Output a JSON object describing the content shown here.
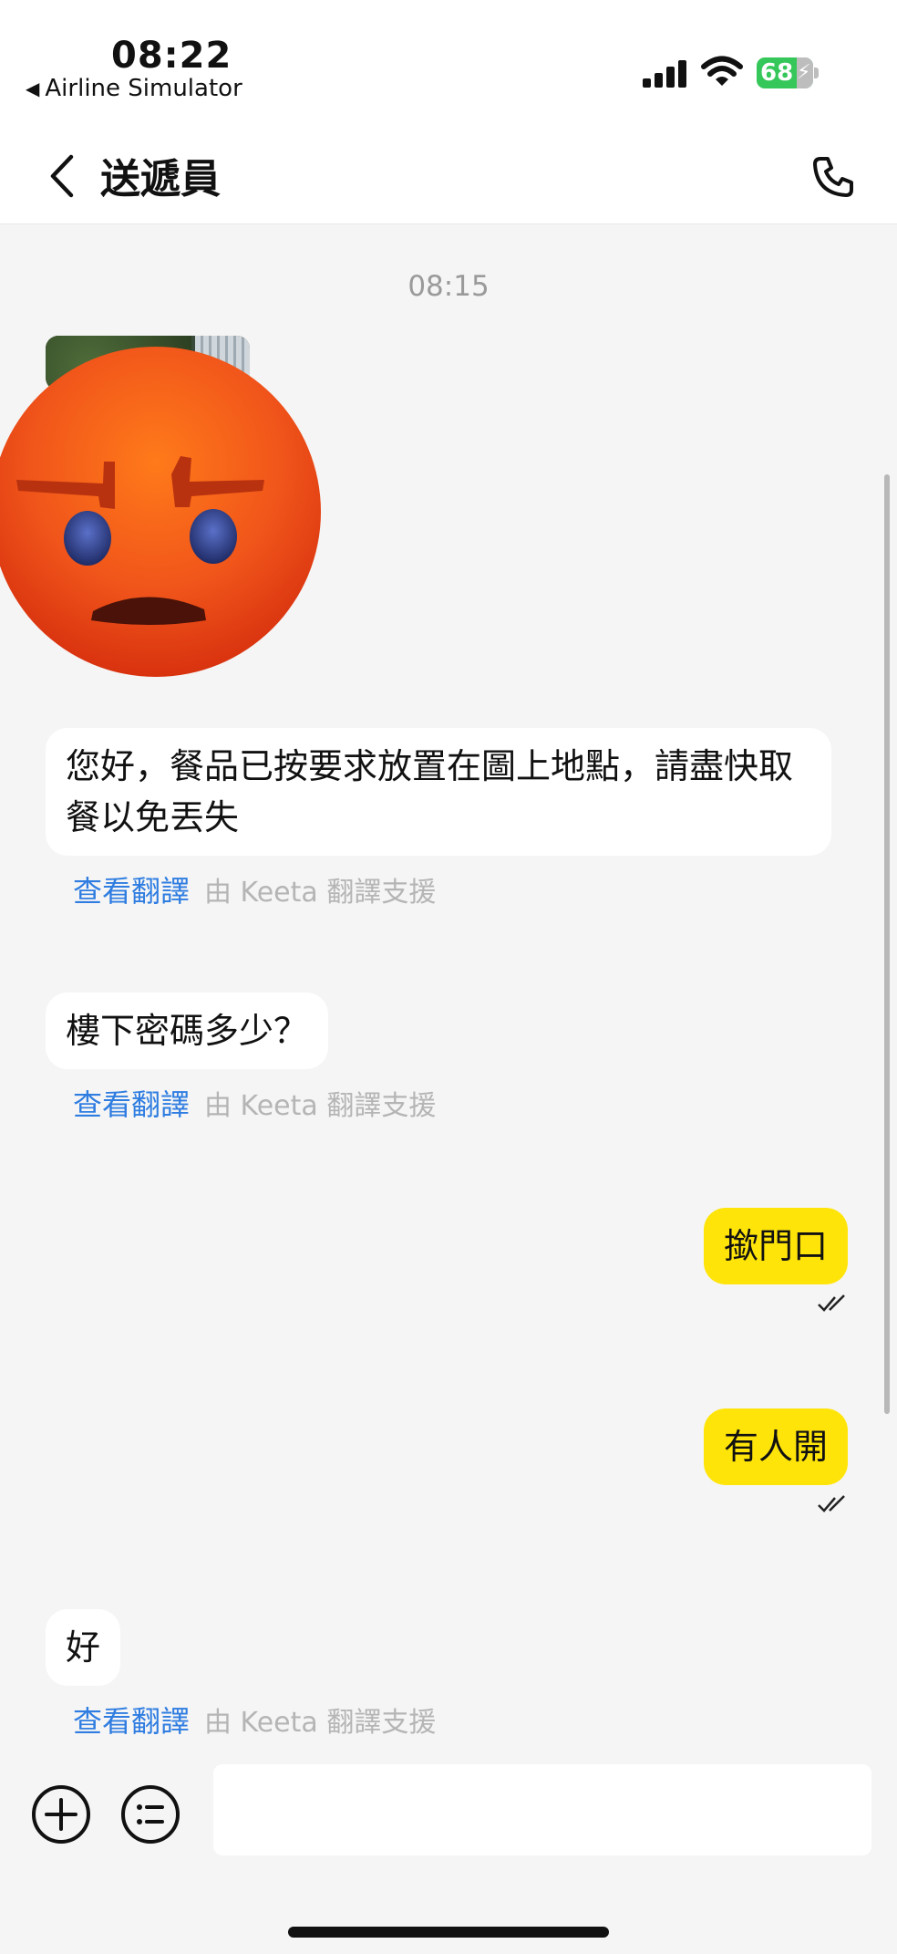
{
  "status_bar": {
    "time": "08:22",
    "back_app": "Airline Simulator",
    "back_arrow": "◀",
    "battery_level": "68",
    "battery_color": "#35c759",
    "icons": [
      "cellular-signal-icon",
      "wifi-icon",
      "battery-charging-icon"
    ]
  },
  "nav": {
    "title": "送遞員",
    "back_icon": "chevron-left-icon",
    "call_icon": "phone-icon"
  },
  "chat": {
    "timestamp": "08:15",
    "messages": [
      {
        "direction": "incoming",
        "type": "image",
        "content": "photo with angry-face emoji overlay"
      },
      {
        "direction": "incoming",
        "type": "text",
        "text": "您好，餐品已按要求放置在圖上地點，請盡快取餐以免丟失",
        "translate_link": "查看翻譯",
        "translate_note": "由 Keeta 翻譯支援"
      },
      {
        "direction": "incoming",
        "type": "text",
        "text": "樓下密碼多少？",
        "translate_link": "查看翻譯",
        "translate_note": "由 Keeta 翻譯支援"
      },
      {
        "direction": "outgoing",
        "type": "text",
        "text": "撳門口",
        "status": "read"
      },
      {
        "direction": "outgoing",
        "type": "text",
        "text": "有人開",
        "status": "read"
      },
      {
        "direction": "incoming",
        "type": "text",
        "text": "好",
        "translate_link": "查看翻譯",
        "translate_note": "由 Keeta 翻譯支援"
      }
    ]
  },
  "input_bar": {
    "plus_icon": "plus-circle-icon",
    "menu_icon": "list-circle-icon",
    "placeholder": ""
  },
  "colors": {
    "outgoing_bubble": "#ffe40a",
    "link": "#2f7de1",
    "background": "#f5f5f5"
  }
}
